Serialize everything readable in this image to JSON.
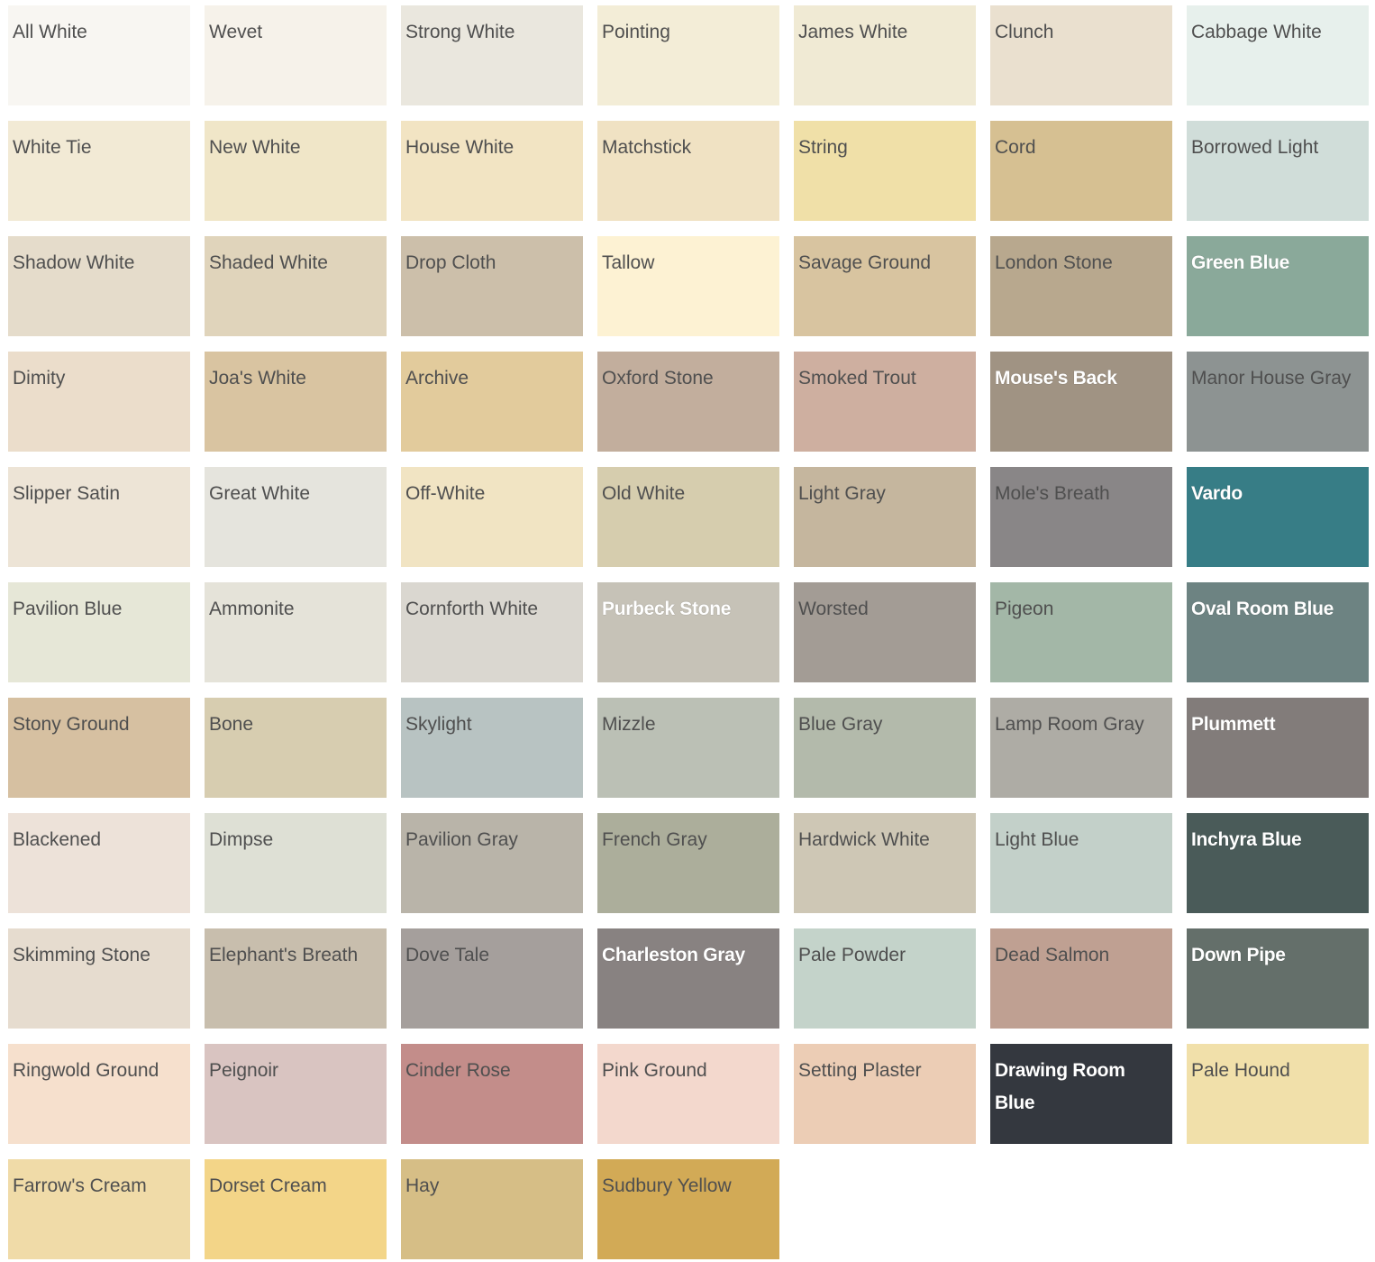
{
  "swatches": [
    {
      "name": "All White",
      "color": "#F8F6F2",
      "text": "dark"
    },
    {
      "name": "Wevet",
      "color": "#F6F2EA",
      "text": "dark"
    },
    {
      "name": "Strong White",
      "color": "#EAE7DE",
      "text": "dark"
    },
    {
      "name": "Pointing",
      "color": "#F3EDD7",
      "text": "dark"
    },
    {
      "name": "James White",
      "color": "#F0EAD4",
      "text": "dark"
    },
    {
      "name": "Clunch",
      "color": "#EAE0CF",
      "text": "dark"
    },
    {
      "name": "Cabbage White",
      "color": "#E7F0EC",
      "text": "dark"
    },
    {
      "name": "White Tie",
      "color": "#F2EAD5",
      "text": "dark"
    },
    {
      "name": "New White",
      "color": "#F0E6C8",
      "text": "dark"
    },
    {
      "name": "House White",
      "color": "#F2E4C3",
      "text": "dark"
    },
    {
      "name": "Matchstick",
      "color": "#F0E2C3",
      "text": "dark"
    },
    {
      "name": "String",
      "color": "#F0E0A8",
      "text": "dark"
    },
    {
      "name": "Cord",
      "color": "#D6C092",
      "text": "dark"
    },
    {
      "name": "Borrowed Light",
      "color": "#D0DDD9",
      "text": "dark"
    },
    {
      "name": "Shadow White",
      "color": "#E5DCCB",
      "text": "dark"
    },
    {
      "name": "Shaded White",
      "color": "#E0D4BB",
      "text": "dark"
    },
    {
      "name": "Drop Cloth",
      "color": "#CCBFAA",
      "text": "dark"
    },
    {
      "name": "Tallow",
      "color": "#FDF2D3",
      "text": "dark"
    },
    {
      "name": "Savage Ground",
      "color": "#D8C4A0",
      "text": "dark"
    },
    {
      "name": "London Stone",
      "color": "#B8A88E",
      "text": "dark"
    },
    {
      "name": "Green Blue",
      "color": "#8AA99A",
      "text": "light"
    },
    {
      "name": "Dimity",
      "color": "#EBDDCB",
      "text": "dark"
    },
    {
      "name": "Joa's White",
      "color": "#D9C4A1",
      "text": "dark"
    },
    {
      "name": "Archive",
      "color": "#E2CB9C",
      "text": "dark"
    },
    {
      "name": "Oxford Stone",
      "color": "#C2AE9D",
      "text": "dark"
    },
    {
      "name": "Smoked Trout",
      "color": "#CEAFA0",
      "text": "dark"
    },
    {
      "name": "Mouse's Back",
      "color": "#A09383",
      "text": "light"
    },
    {
      "name": "Manor House Gray",
      "color": "#8D9392",
      "text": "dark"
    },
    {
      "name": "Slipper Satin",
      "color": "#EDE4D6",
      "text": "dark"
    },
    {
      "name": "Great White",
      "color": "#E5E4DD",
      "text": "dark"
    },
    {
      "name": "Off-White",
      "color": "#F1E4C3",
      "text": "dark"
    },
    {
      "name": "Old White",
      "color": "#D6CDAE",
      "text": "dark"
    },
    {
      "name": "Light Gray",
      "color": "#C5B69E",
      "text": "dark"
    },
    {
      "name": "Mole's Breath",
      "color": "#898687",
      "text": "dark"
    },
    {
      "name": "Vardo",
      "color": "#377D86",
      "text": "light"
    },
    {
      "name": "Pavilion Blue",
      "color": "#E6E7D7",
      "text": "dark"
    },
    {
      "name": "Ammonite",
      "color": "#E5E3D9",
      "text": "dark"
    },
    {
      "name": "Cornforth White",
      "color": "#DAD7D0",
      "text": "dark"
    },
    {
      "name": "Purbeck Stone",
      "color": "#C6C2B7",
      "text": "light"
    },
    {
      "name": "Worsted",
      "color": "#A39C95",
      "text": "dark"
    },
    {
      "name": "Pigeon",
      "color": "#A3B7A7",
      "text": "dark"
    },
    {
      "name": "Oval Room Blue",
      "color": "#6D8382",
      "text": "light"
    },
    {
      "name": "Stony Ground",
      "color": "#D6C0A1",
      "text": "dark"
    },
    {
      "name": "Bone",
      "color": "#D7CDB0",
      "text": "dark"
    },
    {
      "name": "Skylight",
      "color": "#B8C3C2",
      "text": "dark"
    },
    {
      "name": "Mizzle",
      "color": "#BBC0B5",
      "text": "dark"
    },
    {
      "name": "Blue Gray",
      "color": "#B3BAAB",
      "text": "dark"
    },
    {
      "name": "Lamp Room Gray",
      "color": "#AEACA5",
      "text": "dark"
    },
    {
      "name": "Plummett",
      "color": "#827C7A",
      "text": "light"
    },
    {
      "name": "Blackened",
      "color": "#EDE2D9",
      "text": "dark"
    },
    {
      "name": "Dimpse",
      "color": "#DEE0D5",
      "text": "dark"
    },
    {
      "name": "Pavilion Gray",
      "color": "#B9B4A9",
      "text": "dark"
    },
    {
      "name": "French Gray",
      "color": "#ACAE9B",
      "text": "dark"
    },
    {
      "name": "Hardwick White",
      "color": "#CEC7B5",
      "text": "dark"
    },
    {
      "name": "Light Blue",
      "color": "#C3D0C9",
      "text": "dark"
    },
    {
      "name": "Inchyra Blue",
      "color": "#4A5B59",
      "text": "light"
    },
    {
      "name": "Skimming Stone",
      "color": "#E6DCCF",
      "text": "dark"
    },
    {
      "name": "Elephant's Breath",
      "color": "#C8BEAD",
      "text": "dark"
    },
    {
      "name": "Dove Tale",
      "color": "#A59F9C",
      "text": "dark"
    },
    {
      "name": "Charleston Gray",
      "color": "#888281",
      "text": "light"
    },
    {
      "name": "Pale Powder",
      "color": "#C4D3CA",
      "text": "dark"
    },
    {
      "name": "Dead Salmon",
      "color": "#BFA092",
      "text": "dark"
    },
    {
      "name": "Down Pipe",
      "color": "#646F6A",
      "text": "light"
    },
    {
      "name": "Ringwold Ground",
      "color": "#F6E0CD",
      "text": "dark"
    },
    {
      "name": "Peignoir",
      "color": "#D9C4C1",
      "text": "dark"
    },
    {
      "name": "Cinder Rose",
      "color": "#C38D8A",
      "text": "dark"
    },
    {
      "name": "Pink Ground",
      "color": "#F3D8CD",
      "text": "dark"
    },
    {
      "name": "Setting Plaster",
      "color": "#ECCDB5",
      "text": "dark"
    },
    {
      "name": "Drawing Room Blue",
      "color": "#34383F",
      "text": "light"
    },
    {
      "name": "Pale Hound",
      "color": "#F1E0AA",
      "text": "dark"
    },
    {
      "name": "Farrow's Cream",
      "color": "#F0DBA8",
      "text": "dark"
    },
    {
      "name": "Dorset Cream",
      "color": "#F3D588",
      "text": "dark"
    },
    {
      "name": "Hay",
      "color": "#D6BE86",
      "text": "dark"
    },
    {
      "name": "Sudbury Yellow",
      "color": "#D2AA56",
      "text": "dark"
    }
  ]
}
